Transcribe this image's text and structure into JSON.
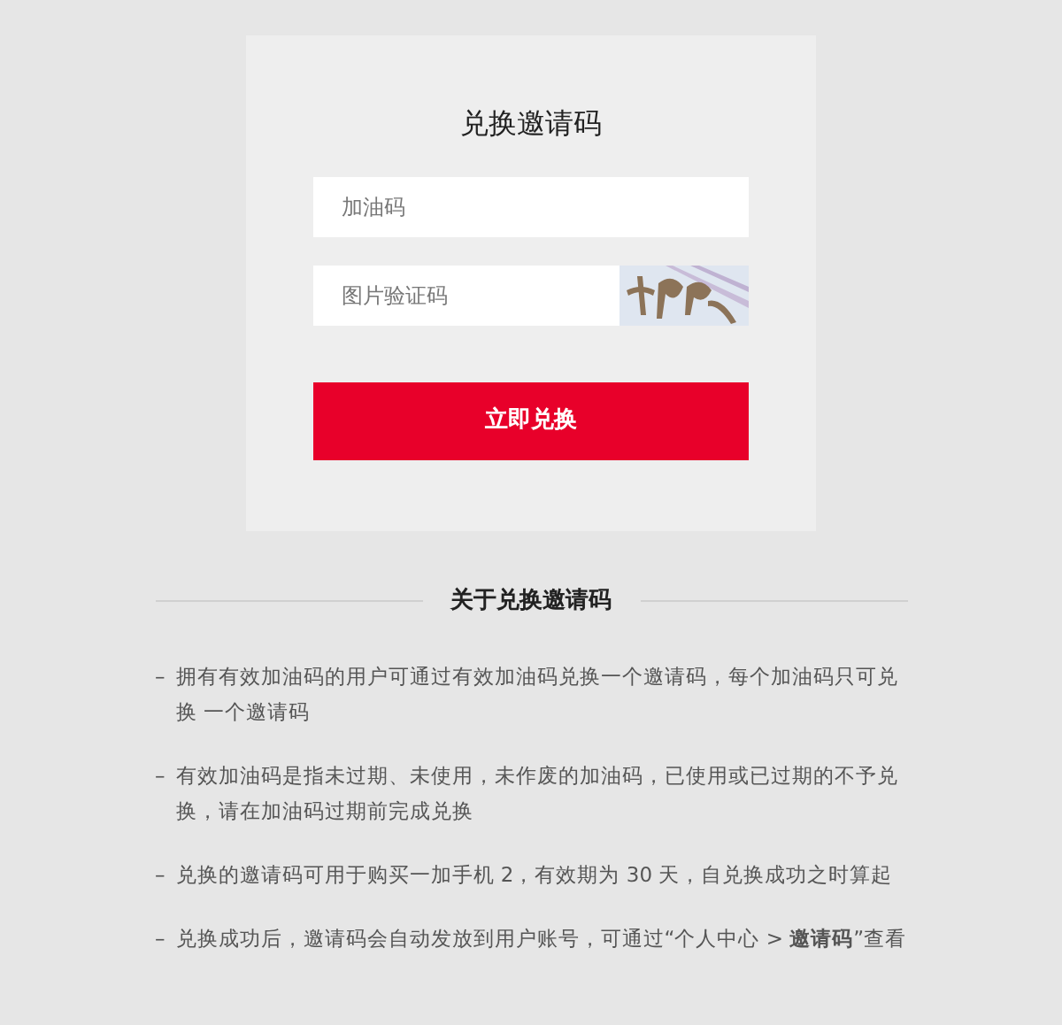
{
  "form": {
    "title": "兑换邀请码",
    "code_field": {
      "placeholder": "加油码"
    },
    "captcha_field": {
      "placeholder": "图片验证码"
    },
    "submit": "立即兑换"
  },
  "about": {
    "heading": "关于兑换邀请码",
    "items": [
      {
        "marker": "–",
        "text": "拥有有效加油码的用户可通过有效加油码兑换一个邀请码，每个加油码只可兑换 一个邀请码"
      },
      {
        "marker": "–",
        "text": "有效加油码是指未过期、未使用，未作废的加油码，已使用或已过期的不予兑换，请在加油码过期前完成兑换"
      },
      {
        "marker": "–",
        "text": "兑换的邀请码可用于购买一加手机 2，有效期为 30 天，自兑换成功之时算起"
      },
      {
        "marker": "–",
        "text": "兑换成功后，邀请码会自动发放到用户账号，可通过“个人中心 > **邀请码**”查看"
      }
    ]
  }
}
